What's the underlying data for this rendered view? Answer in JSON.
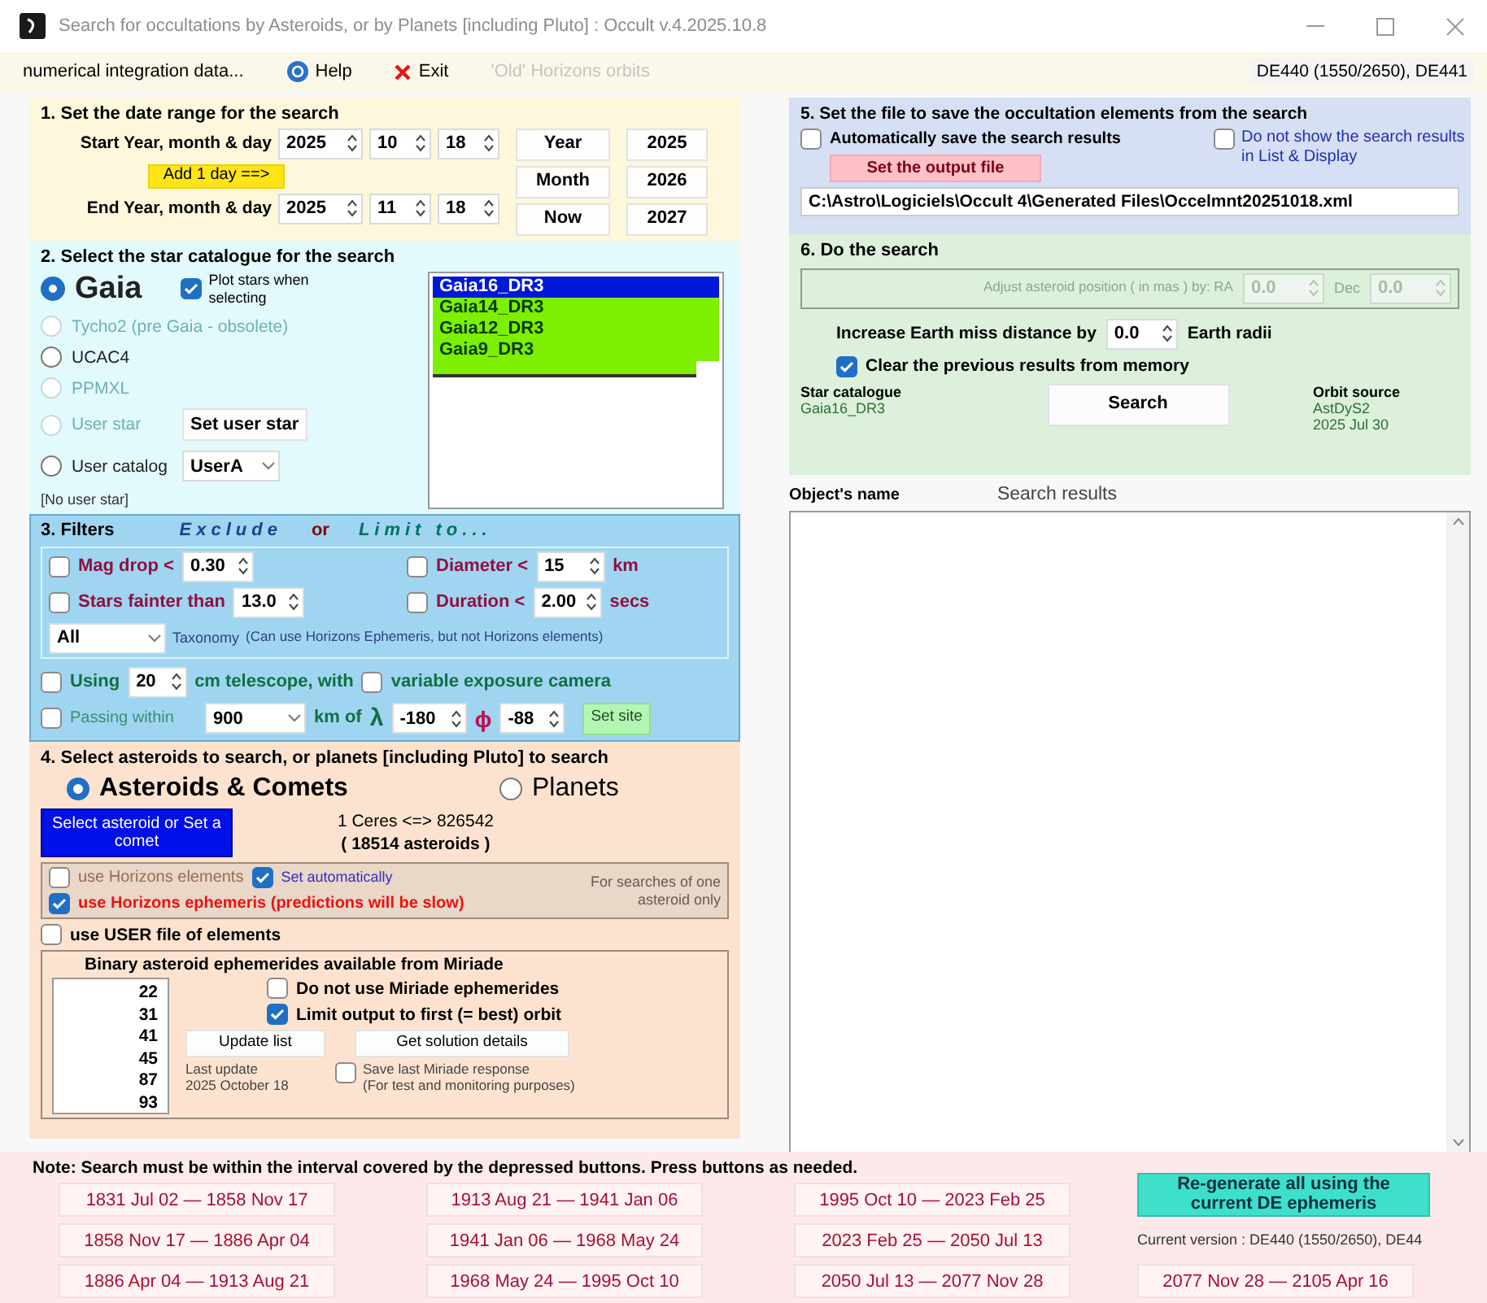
{
  "window": {
    "title": "Search for occultations by Asteroids, or by Planets [including Pluto] : Occult v.4.2025.10.8"
  },
  "menu": {
    "items": [
      {
        "label": "numerical integration data...",
        "kind": "text",
        "disabled": false
      },
      {
        "label": "Help",
        "kind": "help",
        "disabled": false
      },
      {
        "label": "Exit",
        "kind": "exit",
        "disabled": false
      },
      {
        "label": "'Old' Horizons orbits",
        "kind": "text",
        "disabled": true
      }
    ],
    "ephemeris": "DE440 (1550/2650), DE441"
  },
  "date_range": {
    "title": "1.  Set the date range for the search",
    "start": {
      "label": "Start Year, month  & day",
      "year": "2025",
      "month": "10",
      "day": "18"
    },
    "add_day": "Add 1 day ==>",
    "end": {
      "label": "End Year, month & day",
      "year": "2025",
      "month": "11",
      "day": "18"
    },
    "unit_buttons": [
      "Year",
      "Month",
      "Now"
    ],
    "year_buttons": [
      "2025",
      "2026",
      "2027"
    ]
  },
  "star_catalogue": {
    "title": "2.  Select the star catalogue for the search",
    "options": [
      {
        "label": "Gaia",
        "kind": "large",
        "selected": true,
        "disabled": false,
        "checkbox": {
          "label": "Plot stars when selecting",
          "checked": true
        }
      },
      {
        "label": "Tycho2 (pre Gaia - obsolete)",
        "kind": "plain",
        "selected": false,
        "disabled": true
      },
      {
        "label": "UCAC4",
        "kind": "plain",
        "selected": false,
        "disabled": false
      },
      {
        "label": "PPMXL",
        "kind": "plain",
        "selected": false,
        "disabled": true
      },
      {
        "label": "User star",
        "kind": "plain",
        "selected": false,
        "disabled": true,
        "button": "Set user star"
      },
      {
        "label": "User catalog",
        "kind": "plain",
        "selected": false,
        "disabled": false,
        "dropdown": "UserA"
      }
    ],
    "user_star_note": "[No user star]",
    "catalogues": [
      {
        "label": "Gaia16_DR3",
        "selected": true
      },
      {
        "label": "Gaia14_DR3",
        "selected": false
      },
      {
        "label": "Gaia12_DR3",
        "selected": false
      },
      {
        "label": "Gaia9_DR3",
        "selected": false
      }
    ]
  },
  "filters": {
    "title": "3.  Filters",
    "exclude": "Exclude",
    "or": "or",
    "limit": "Limit to...",
    "mag_drop": {
      "label": "Mag drop <",
      "value": "0.30",
      "checked": false
    },
    "diameter": {
      "label": "Diameter <",
      "value": "15",
      "unit": "km",
      "checked": false
    },
    "fainter": {
      "label": "Stars fainter than",
      "value": "13.0",
      "checked": false
    },
    "duration": {
      "label": "Duration <",
      "value": "2.00",
      "unit": "secs",
      "checked": false
    },
    "taxonomy": {
      "value": "All",
      "label": "Taxonomy",
      "note": "(Can use Horizons Ephemeris, but not Horizons elements)"
    },
    "telescope": {
      "checked": false,
      "label": "Using",
      "value": "20",
      "after": "cm telescope, with",
      "camera": {
        "label": "variable exposure camera",
        "checked": false
      }
    },
    "site": {
      "checked": false,
      "label": "Passing within",
      "distance": "900",
      "unit": "km of",
      "lambda_symbol": "λ",
      "longitude": "-180",
      "phi_symbol": "ϕ",
      "latitude": "-88",
      "button": "Set site"
    }
  },
  "asteroid_search": {
    "title": "4.  Select asteroids to search, or planets [including Pluto] to search",
    "targets": [
      {
        "label": "Asteroids & Comets",
        "selected": true
      },
      {
        "label": "Planets",
        "selected": false
      }
    ],
    "select_button": "Select asteroid or Set a comet",
    "range": "1 Ceres <=> 826542",
    "count": "( 18514 asteroids )",
    "horizons": {
      "elements": {
        "label": "use Horizons elements",
        "checked": false
      },
      "auto": {
        "label": "Set automatically",
        "checked": true
      },
      "ephemeris": {
        "label": "use Horizons ephemeris (predictions will be slow)",
        "checked": true
      },
      "note": "For searches of one asteroid only"
    },
    "user_file": {
      "label": "use USER file of elements",
      "checked": false
    },
    "binary": {
      "title": "Binary asteroid ephemerides available from Miriade",
      "numbers": [
        "22",
        "31",
        "41",
        "45",
        "87",
        "93"
      ],
      "no_miriade": {
        "label": "Do not use Miriade ephemerides",
        "checked": false
      },
      "limit_first": {
        "label": "Limit output to first (= best) orbit",
        "checked": true
      },
      "update": "Update list",
      "details": "Get solution details",
      "last_update_label": "Last update",
      "last_update": "2025 October 18",
      "save": {
        "label": "Save last Miriade response",
        "checked": false,
        "note": "(For test and monitoring purposes)"
      }
    }
  },
  "output_file": {
    "title": "5.  Set the file to save the occultation elements from the search",
    "auto_save": {
      "label": "Automatically save the search results",
      "checked": false
    },
    "hide_results": {
      "label": "Do not show the search results in List & Display",
      "checked": false
    },
    "button": "Set the output file",
    "path": "C:\\Astro\\Logiciels\\Occult 4\\Generated Files\\Occelmnt20251018.xml"
  },
  "search": {
    "title": "6.  Do the search",
    "adjust": {
      "label": "Adjust asteroid position ( in mas ) by:  RA",
      "ra": "0.0",
      "dec_label": "Dec",
      "dec": "0.0",
      "disabled": true
    },
    "miss": {
      "label": "Increase Earth miss distance by",
      "value": "0.0",
      "unit": "Earth radii"
    },
    "clear": {
      "label": "Clear the previous results from memory",
      "checked": true
    },
    "catalogue_label": "Star catalogue",
    "catalogue": "Gaia16_DR3",
    "button": "Search",
    "orbit_label": "Orbit source",
    "orbit_source": "AstDyS2",
    "orbit_date": "2025 Jul 30"
  },
  "results": {
    "name_heading": "Object's name",
    "heading": "Search results"
  },
  "ephemeris_intervals": {
    "note": "Note:  Search must be within the interval covered by the depressed buttons.  Press buttons as needed.",
    "intervals": [
      "1831 Jul 02 — 1858 Nov 17",
      "1858 Nov 17 — 1886 Apr 04",
      "1886 Apr 04 — 1913 Aug 21",
      "1913 Aug 21 — 1941 Jan 06",
      "1941 Jan 06 — 1968 May 24",
      "1968 May 24 — 1995 Oct 10",
      "1995 Oct 10 — 2023 Feb 25",
      "2023 Feb 25 — 2050 Jul 13",
      "2050 Jul 13 — 2077 Nov 28",
      "2077 Nov 28 — 2105 Apr 16"
    ],
    "regenerate": "Re-generate all using the current DE ephemeris",
    "current_version": "Current version : DE440 (1550/2650), DE44"
  }
}
